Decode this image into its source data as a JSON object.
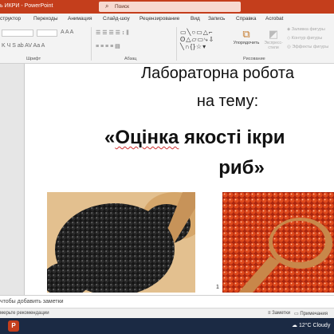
{
  "titlebar": {
    "title": "ь ИКРИ  -  PowerPoint",
    "search_placeholder": "Поиск"
  },
  "tabs": [
    "структор",
    "Переходы",
    "Анимация",
    "Слайд-шоу",
    "Рецензирование",
    "Вид",
    "Запись",
    "Справка",
    "Acrobat"
  ],
  "ribbon": {
    "font_group": "Шрифт",
    "paragraph_group": "Абзац",
    "drawing_group": "Рисование",
    "arrange_label": "Упорядочить",
    "quick_styles_label": "Экспресс-стили",
    "fill_label": "Заливка фигуры",
    "outline_label": "Контур фигуры",
    "effects_label": "Эффекты фигуры"
  },
  "slide": {
    "line1": "Лабораторна робота",
    "line2": "на тему:",
    "line3_pre": "«",
    "line3_word": "Оцінка",
    "line3_post": " якості ікри",
    "line4": "риб»",
    "page_number": "1",
    "images": [
      "black-caviar",
      "red-caviar"
    ]
  },
  "notes": {
    "placeholder": "чтобы добавить заметки"
  },
  "statusbar": {
    "left": "мерьте рекомендации",
    "notes_btn": "Заметки",
    "comments_btn": "Примечания"
  },
  "taskbar": {
    "app_icon": "P",
    "weather": "12°C  Cloudy"
  },
  "colors": {
    "accent": "#c43e1c"
  }
}
